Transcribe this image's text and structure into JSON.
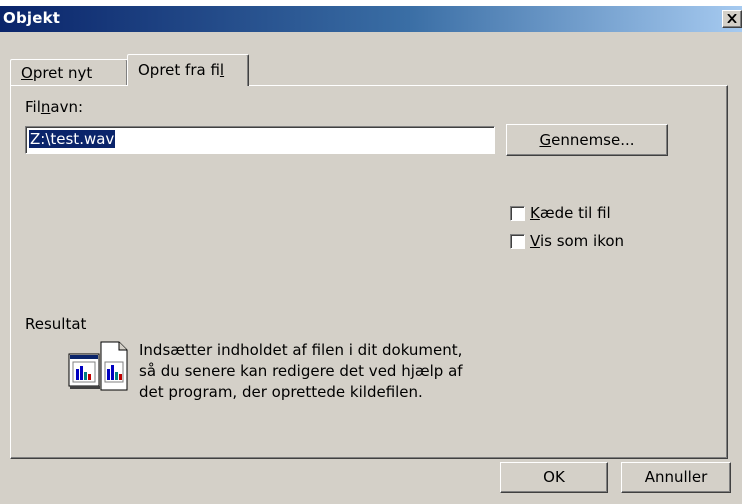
{
  "window": {
    "title": "Objekt"
  },
  "tabs": [
    {
      "label_pre": "",
      "label_u": "O",
      "label_post": "pret nyt"
    },
    {
      "label_pre": "Opret fra fi",
      "label_u": "l",
      "label_post": ""
    }
  ],
  "panel": {
    "filename_label": {
      "pre": "Fil",
      "u": "n",
      "post": "avn:"
    },
    "filename_value": "Z:\\test.wav",
    "browse_button": {
      "u": "G",
      "post": "ennemse..."
    },
    "link_checkbox": {
      "u": "K",
      "post": "æde til fil",
      "checked": false
    },
    "icon_checkbox": {
      "u": "V",
      "post": "is som ikon",
      "checked": false
    },
    "result_label": "Resultat",
    "result_line1": "Indsætter indholdet af filen i dit dokument,",
    "result_line2": "så du senere kan redigere det ved hjælp af",
    "result_line3": "det program, der oprettede kildefilen.",
    "result_icon": "embed-object-icon"
  },
  "footer": {
    "ok_label": "OK",
    "cancel_label": "Annuller"
  },
  "colors": {
    "title_start": "#0a246a",
    "title_end": "#a6caf0",
    "face": "#d4d0c8",
    "selection": "#0a246a"
  }
}
